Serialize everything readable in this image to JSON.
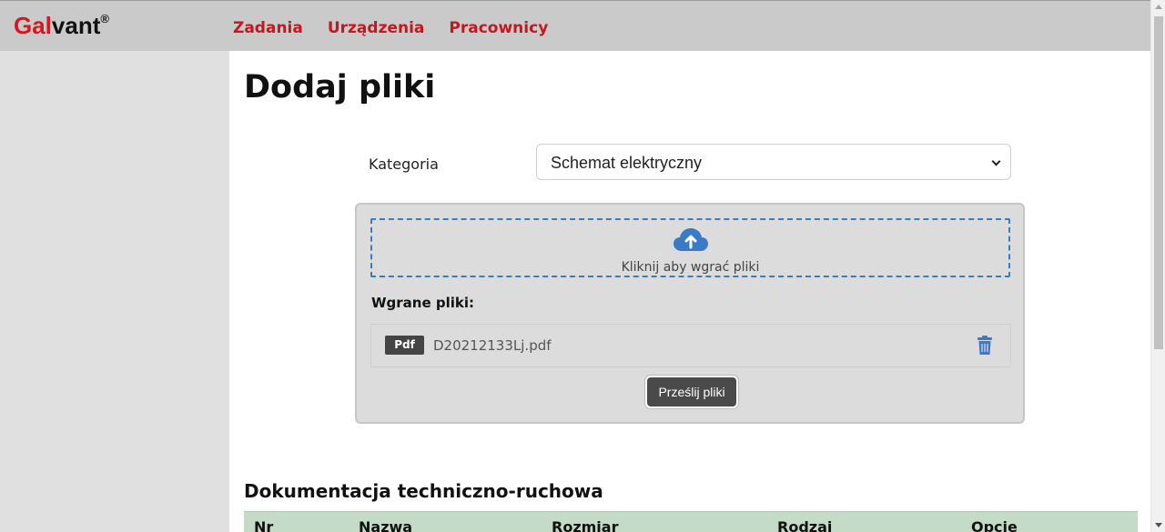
{
  "brand": {
    "part1": "Gal",
    "part2": "vant",
    "mark": "®"
  },
  "nav": [
    {
      "label": "Zadania"
    },
    {
      "label": "Urządzenia"
    },
    {
      "label": "Pracownicy"
    }
  ],
  "page": {
    "title": "Dodaj pliki"
  },
  "form": {
    "category_label": "Kategoria",
    "category_value": "Schemat elektryczny"
  },
  "upload": {
    "dropzone_text": "Kliknij aby wgrać pliki",
    "uploaded_label": "Wgrane pliki:",
    "files": [
      {
        "type": "Pdf",
        "name": "D20212133Lj.pdf"
      }
    ],
    "send_label": "Prześlij pliki"
  },
  "docs": {
    "title": "Dokumentacja techniczno-ruchowa",
    "columns": [
      "Nr",
      "Nazwa",
      "Rozmiar",
      "Rodzaj",
      "Opcje"
    ]
  },
  "colors": {
    "brand_red": "#d11a22",
    "nav_red": "#c8161e",
    "accent_blue": "#3a7cc4",
    "table_header": "#c3dbc7"
  },
  "icons": {
    "upload": "cloud-upload-icon",
    "delete": "trash-icon"
  }
}
